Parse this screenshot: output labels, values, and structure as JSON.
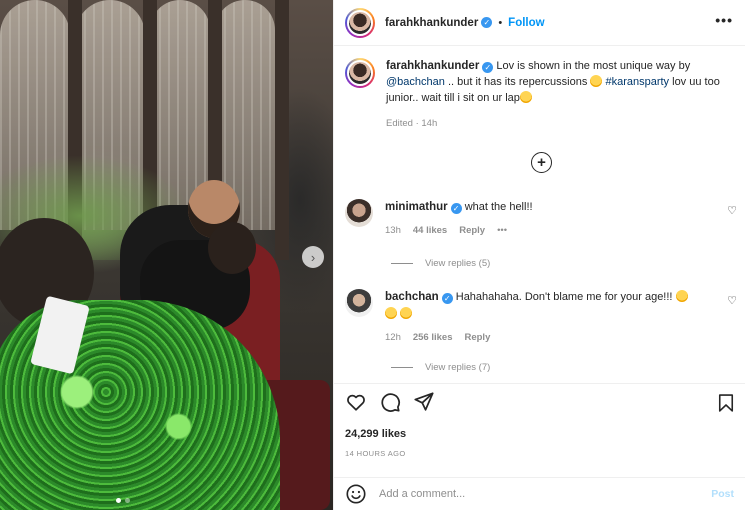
{
  "post": {
    "username": "farahkhankunder",
    "follow_label": "Follow",
    "header_separator": "•",
    "more_label": "•••",
    "carousel_next": "›",
    "carousel_total": 2,
    "carousel_active": 1
  },
  "caption": {
    "username": "farahkhankunder",
    "text_1": "Lov is shown in the most unique way by",
    "mention": "@bachchan",
    "text_2": ".. but it has its repercussions",
    "hashtag": "#karansparty",
    "text_3": "lov uu too junior.. wait till i sit on ur lap",
    "edited": "Edited",
    "age": "14h"
  },
  "comments": [
    {
      "username": "minimathur",
      "text": "what the hell!!",
      "age": "13h",
      "likes": "44 likes",
      "reply_label": "Reply",
      "more_label": "•••",
      "view_replies": "View replies (5)"
    },
    {
      "username": "bachchan",
      "text": "Hahahahaha. Don't blame me for your age!!!",
      "age": "12h",
      "likes": "256 likes",
      "reply_label": "Reply",
      "view_replies": "View replies (7)"
    }
  ],
  "engagement": {
    "likes": "24,299 likes",
    "timestamp": "14 HOURS AGO"
  },
  "comment_box": {
    "placeholder": "Add a comment...",
    "post_label": "Post"
  },
  "icons": {
    "verified": "verified-badge-icon",
    "heart": "heart-icon",
    "comment": "comment-icon",
    "share": "share-icon",
    "save": "bookmark-icon",
    "emoji": "emoji-icon",
    "add": "plus-circle-icon"
  },
  "colors": {
    "link": "#00376b",
    "follow": "#0095f6",
    "verified": "#3897f0",
    "muted": "#8e8e8e",
    "post_disabled": "#b2dffc"
  }
}
